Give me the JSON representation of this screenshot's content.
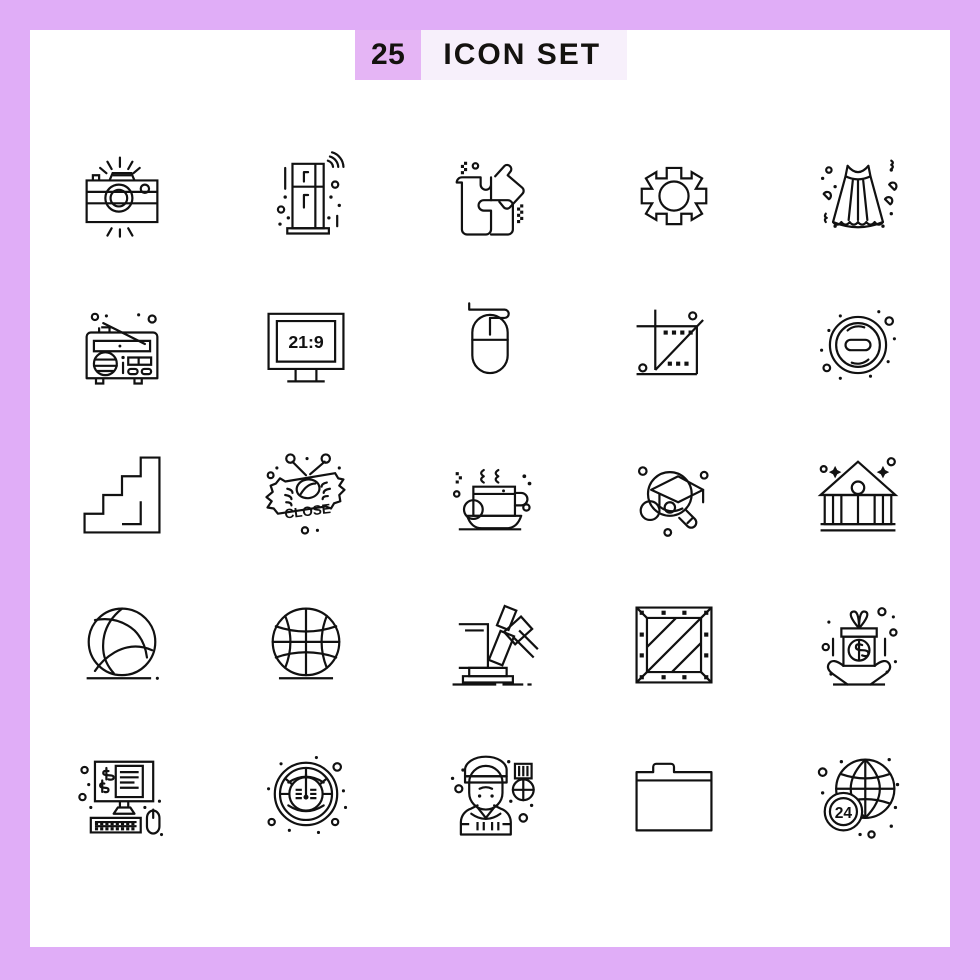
{
  "header": {
    "count": "25",
    "title": "ICON SET"
  },
  "colors": {
    "border": "#e0adf7",
    "canvas": "#ffffff",
    "count_badge": "#e5b5f5",
    "title_badge": "#f7f0fb",
    "stroke": "#111111"
  },
  "grid": {
    "columns": 5,
    "rows": 5,
    "total": 25
  },
  "icons": [
    {
      "name": "camera-icon",
      "label": "Camera",
      "row": 1,
      "col": 1
    },
    {
      "name": "smart-refrigerator-icon",
      "label": "Smart Refrigerator",
      "row": 1,
      "col": 2
    },
    {
      "name": "puzzle-icon",
      "label": "Puzzle",
      "row": 1,
      "col": 3
    },
    {
      "name": "gear-icon",
      "label": "Gear Settings",
      "row": 1,
      "col": 4
    },
    {
      "name": "dress-icon",
      "label": "Dress",
      "row": 1,
      "col": 5
    },
    {
      "name": "radio-icon",
      "label": "Radio",
      "row": 2,
      "col": 1
    },
    {
      "name": "monitor-aspect-ratio-icon",
      "label": "Monitor 21:9",
      "row": 2,
      "col": 2,
      "screen_text": "21:9"
    },
    {
      "name": "computer-mouse-icon",
      "label": "Computer Mouse",
      "row": 2,
      "col": 3
    },
    {
      "name": "crop-tool-icon",
      "label": "Crop Tool",
      "row": 2,
      "col": 4
    },
    {
      "name": "minus-circle-icon",
      "label": "Remove Button",
      "row": 2,
      "col": 5
    },
    {
      "name": "stairs-icon",
      "label": "Stairs",
      "row": 3,
      "col": 1
    },
    {
      "name": "close-sign-icon",
      "label": "Close Sign",
      "row": 3,
      "col": 2,
      "sign_text": "CLOSE"
    },
    {
      "name": "coffee-cup-icon",
      "label": "Coffee Cup",
      "row": 3,
      "col": 3
    },
    {
      "name": "education-search-icon",
      "label": "Education Search",
      "row": 3,
      "col": 4
    },
    {
      "name": "bank-building-icon",
      "label": "Bank Building",
      "row": 3,
      "col": 5
    },
    {
      "name": "volleyball-icon",
      "label": "Volleyball",
      "row": 4,
      "col": 1
    },
    {
      "name": "basketball-icon",
      "label": "Basketball",
      "row": 4,
      "col": 2
    },
    {
      "name": "gavel-icon",
      "label": "Gavel Auction",
      "row": 4,
      "col": 3
    },
    {
      "name": "wooden-crate-icon",
      "label": "Wooden Crate",
      "row": 4,
      "col": 4
    },
    {
      "name": "gift-donation-icon",
      "label": "Gift Donation",
      "row": 4,
      "col": 5,
      "symbol": "$"
    },
    {
      "name": "online-banking-icon",
      "label": "Online Banking",
      "row": 5,
      "col": 1,
      "symbol": "$"
    },
    {
      "name": "speedometer-icon",
      "label": "Speedometer",
      "row": 5,
      "col": 2
    },
    {
      "name": "soldier-medal-icon",
      "label": "Soldier With Medal",
      "row": 5,
      "col": 3
    },
    {
      "name": "folder-icon",
      "label": "Folder",
      "row": 5,
      "col": 4
    },
    {
      "name": "global-support-icon",
      "label": "24 Hour Global Support",
      "row": 5,
      "col": 5,
      "badge_text": "24"
    }
  ]
}
